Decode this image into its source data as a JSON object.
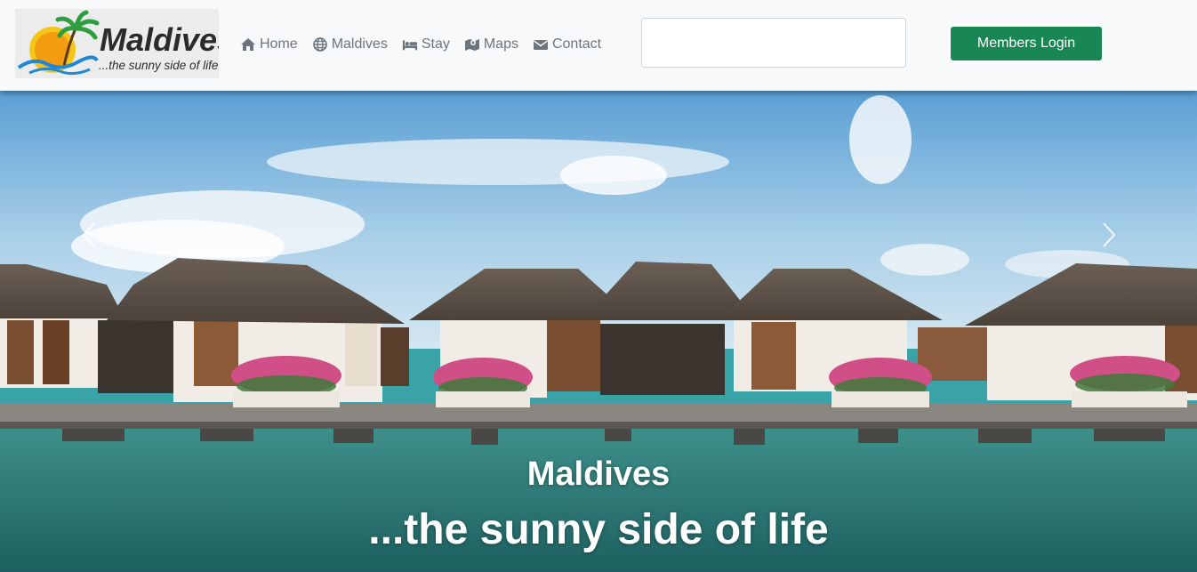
{
  "brand": {
    "logo_text": "Maldives",
    "logo_tagline": "...the sunny side of life"
  },
  "nav": {
    "items": [
      {
        "label": "Home",
        "icon": "home-icon"
      },
      {
        "label": "Maldives",
        "icon": "globe-icon"
      },
      {
        "label": "Stay",
        "icon": "bed-icon"
      },
      {
        "label": "Maps",
        "icon": "map-icon"
      },
      {
        "label": "Contact",
        "icon": "envelope-icon"
      }
    ]
  },
  "search": {
    "value": "",
    "placeholder": ""
  },
  "login": {
    "label": "Members Login"
  },
  "hero": {
    "title": "Maldives",
    "subtitle": "...the sunny side of life"
  },
  "colors": {
    "navbar_bg": "#f8f9fa",
    "nav_text": "#6c757d",
    "login_bg": "#198754"
  }
}
